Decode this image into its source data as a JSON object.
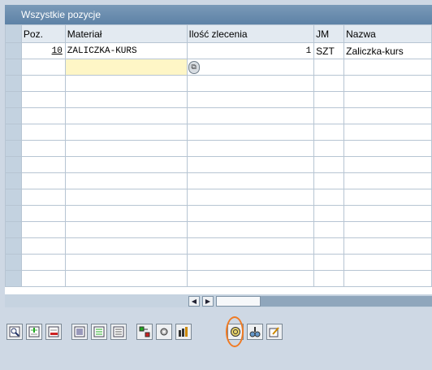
{
  "panel": {
    "title": "Wszystkie pozycje"
  },
  "columns": [
    "Poz.",
    "Materiał",
    "Ilość zlecenia",
    "JM",
    "Nazwa"
  ],
  "rows": [
    {
      "poz": "10",
      "material": "ZALICZKA-KURS",
      "ilosc": "1",
      "jm": "SZT",
      "nazwa": "Zaliczka-kurs"
    }
  ],
  "scrollbar": {
    "left_arrow": "◀",
    "right_arrow": "▶"
  },
  "toolbar": {
    "icons": [
      "details-icon",
      "insert-row-icon",
      "delete-row-icon",
      "select-all-icon",
      "deselect-all-icon",
      "more-icon",
      "conditions-icon",
      "config-icon",
      "columns-icon",
      "availability-icon",
      "product-selection-icon",
      "edit-icon"
    ]
  },
  "colors": {
    "accent_highlight": "#f07a22",
    "header_bg": "#5d82a6",
    "input_yellow": "#fef6c6"
  }
}
